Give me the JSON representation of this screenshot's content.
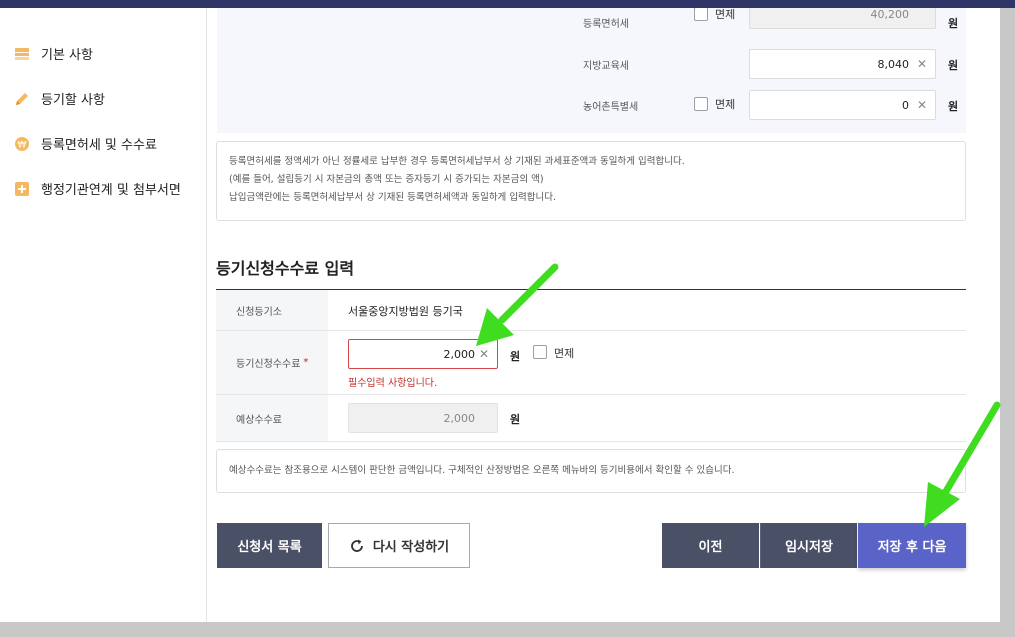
{
  "sidebar": {
    "items": [
      {
        "label": "기본 사항",
        "icon": "list-icon"
      },
      {
        "label": "등기할 사항",
        "icon": "pencil-icon"
      },
      {
        "label": "등록면허세 및 수수료",
        "icon": "coin-icon"
      },
      {
        "label": "행정기관연계 및 첨부서면",
        "icon": "plus-document-icon"
      }
    ]
  },
  "tax": {
    "registration_label": "등록면허세",
    "registration_exempt": "면제",
    "registration_value": "40,200",
    "education_label": "지방교육세",
    "education_value": "8,040",
    "rural_label": "농어촌특별세",
    "rural_exempt": "면제",
    "rural_value": "0",
    "unit": "원"
  },
  "notice1": {
    "line1": "등록면허세를 정액세가 아닌 정률세로 납부한 경우 등록면허세납부서 상 기재된 과세표준액과 동일하게 입력합니다.",
    "line2": "(예를 들어, 설립등기 시 자본금의 총액 또는 증자등기 시 증가되는 자본금의 액)",
    "line3": "납입금액란에는 등록면허세납부서 상 기재된 등록면허세액과 동일하게 입력합니다."
  },
  "fee_section": {
    "title": "등기신청수수료 입력",
    "office_label": "신청등기소",
    "office_value": "서울중앙지방법원 등기국",
    "fee_label": "등기신청수수료",
    "required_mark": "*",
    "fee_value": "2,000",
    "fee_unit": "원",
    "fee_exempt": "면제",
    "error": "필수입력 사항입니다.",
    "expected_label": "예상수수료",
    "expected_value": "2,000",
    "expected_unit": "원"
  },
  "notice2": {
    "text": "예상수수료는 참조용으로 시스템이 판단한 금액입니다. 구체적인 산정방법은 오른쪽 메뉴바의 등기비용에서 확인할 수 있습니다."
  },
  "buttons": {
    "list": "신청서 목록",
    "rewrite": "다시 작성하기",
    "prev": "이전",
    "temp_save": "임시저장",
    "save_next": "저장 후 다음"
  },
  "colors": {
    "accent": "#5a63c7",
    "dark_button": "#4a5066",
    "error": "#c0302a",
    "annotation_arrow": "#3fdc1f"
  }
}
